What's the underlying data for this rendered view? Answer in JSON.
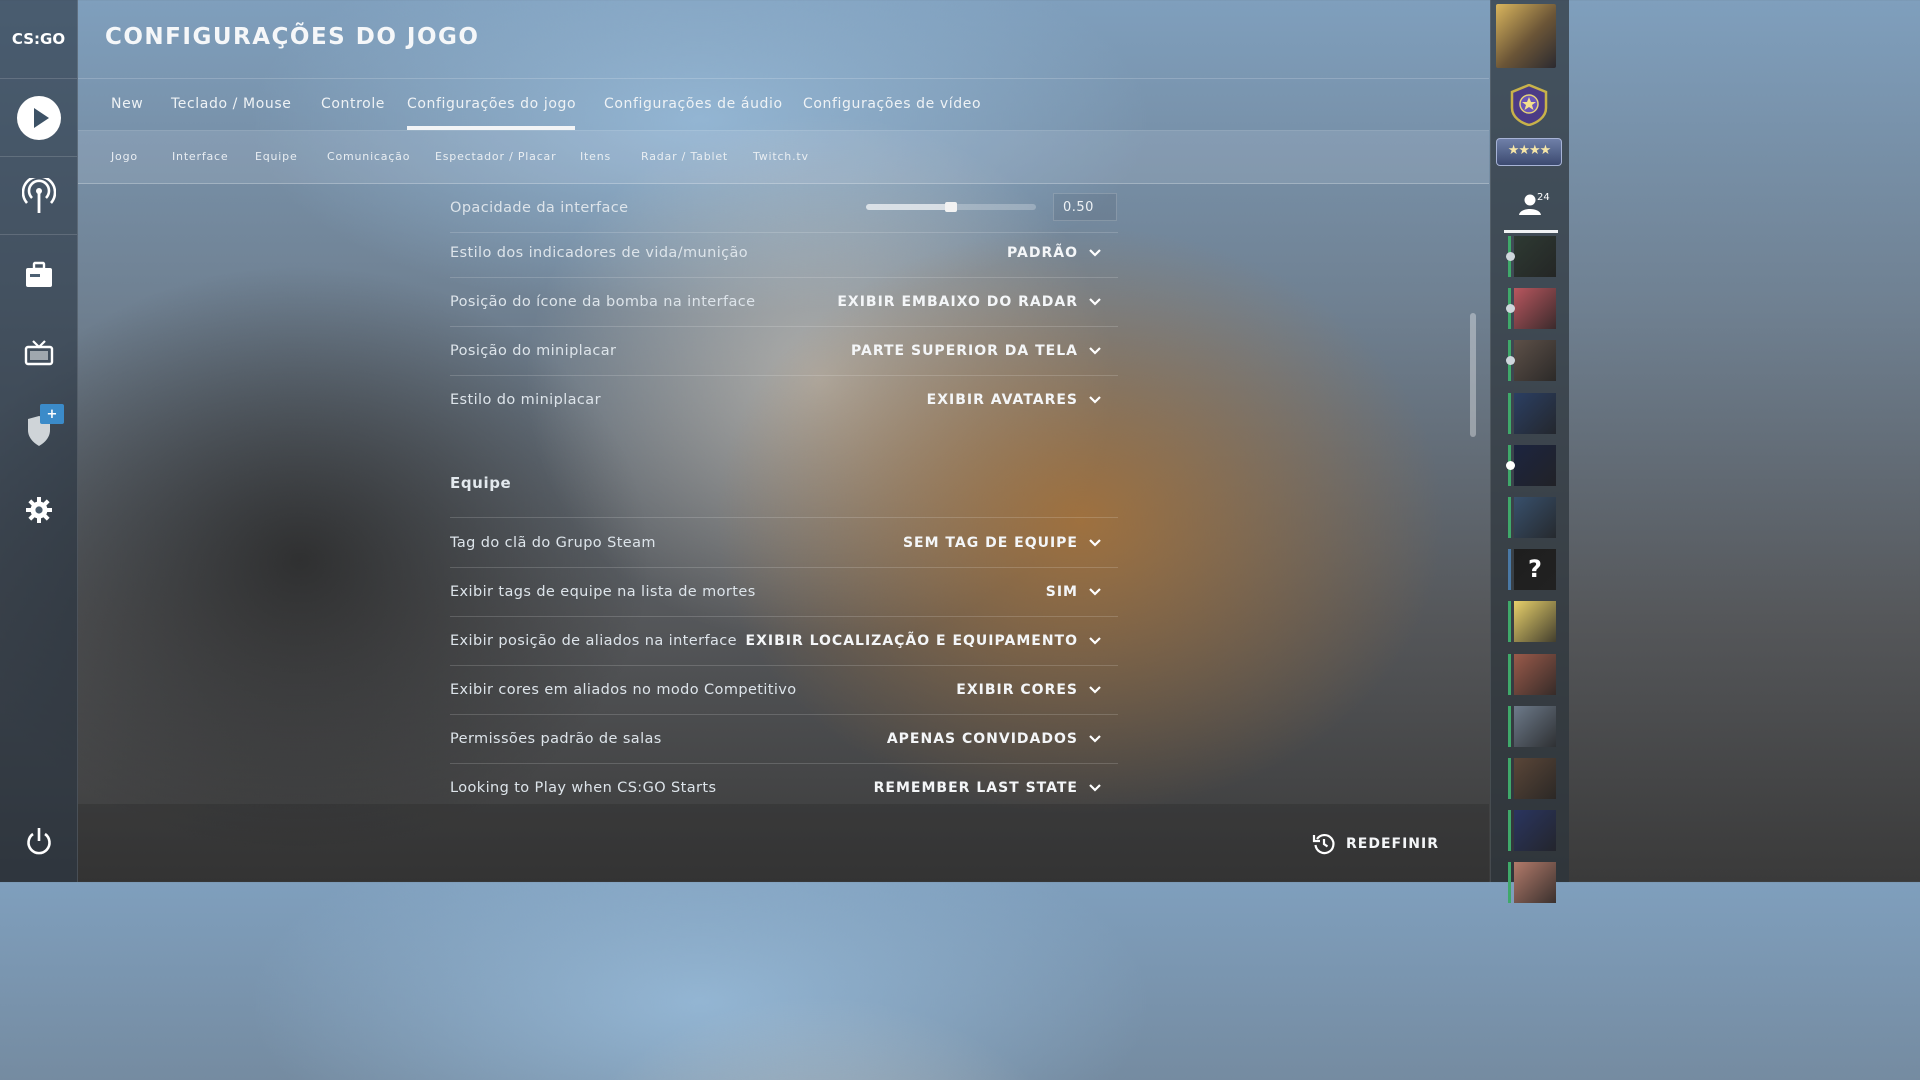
{
  "app": {
    "logo_text": "CS:GO"
  },
  "header": {
    "title": "CONFIGURAÇÕES DO JOGO"
  },
  "tabs": [
    {
      "label": "New"
    },
    {
      "label": "Teclado / Mouse"
    },
    {
      "label": "Controle"
    },
    {
      "label": "Configurações do jogo",
      "active": true
    },
    {
      "label": "Configurações de áudio"
    },
    {
      "label": "Configurações de vídeo"
    }
  ],
  "subtabs": [
    {
      "label": "Jogo"
    },
    {
      "label": "Interface"
    },
    {
      "label": "Equipe"
    },
    {
      "label": "Comunicação"
    },
    {
      "label": "Espectador / Placar"
    },
    {
      "label": "Itens"
    },
    {
      "label": "Radar / Tablet"
    },
    {
      "label": "Twitch.tv"
    }
  ],
  "interface_settings": {
    "opacity": {
      "label": "Opacidade da interface",
      "value": "0.50",
      "slider_fraction": 0.5
    },
    "rows": [
      {
        "label": "Estilo dos indicadores de vida/munição",
        "value": "PADRÃO"
      },
      {
        "label": "Posição do ícone da bomba na interface",
        "value": "EXIBIR EMBAIXO DO RADAR"
      },
      {
        "label": "Posição do miniplacar",
        "value": "PARTE SUPERIOR DA TELA"
      },
      {
        "label": "Estilo do miniplacar",
        "value": "EXIBIR AVATARES"
      }
    ]
  },
  "team_section": {
    "title": "Equipe",
    "rows": [
      {
        "label": "Tag do clã do Grupo Steam",
        "value": "SEM TAG DE EQUIPE"
      },
      {
        "label": "Exibir tags de equipe na lista de mortes",
        "value": "SIM"
      },
      {
        "label": "Exibir posição de aliados na interface",
        "value": "EXIBIR LOCALIZAÇÃO E EQUIPAMENTO"
      },
      {
        "label": "Exibir cores em aliados no modo Competitivo",
        "value": "EXIBIR CORES"
      },
      {
        "label": "Permissões padrão de salas",
        "value": "APENAS CONVIDADOS"
      },
      {
        "label": "Looking to Play when CS:GO Starts",
        "value": "REMEMBER LAST STATE"
      }
    ]
  },
  "footer": {
    "reset_label": "REDEFINIR"
  },
  "rightbar": {
    "rank_stars": "★★★★",
    "friends_count": "24",
    "friends": [
      {
        "color": "#2e3a33",
        "status": "away"
      },
      {
        "color": "#b8565e",
        "status": "away"
      },
      {
        "color": "#5d5048",
        "status": "away"
      },
      {
        "color": "#2b3f63",
        "status": "online"
      },
      {
        "color": "#1c2440",
        "status": "playing"
      },
      {
        "color": "#38506c",
        "status": "online"
      },
      {
        "color": "#1e1e1e",
        "status": "offline",
        "glyph": "?"
      },
      {
        "color": "#e8d06a",
        "status": "online"
      },
      {
        "color": "#9a5a4a",
        "status": "online"
      },
      {
        "color": "#6d7a8a",
        "status": "online"
      },
      {
        "color": "#5a4638",
        "status": "online"
      },
      {
        "color": "#2a3560",
        "status": "online"
      },
      {
        "color": "#b27a6a",
        "status": "online"
      }
    ]
  }
}
